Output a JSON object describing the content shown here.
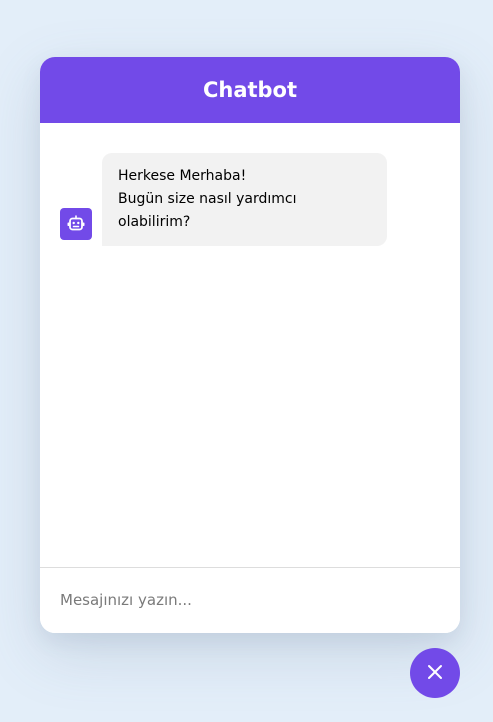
{
  "header": {
    "title": "Chatbot"
  },
  "messages": [
    {
      "sender": "bot",
      "icon": "robot-icon",
      "lines": [
        "Herkese Merhaba!",
        "Bugün size nasıl yardımcı",
        "olabilirim?"
      ]
    }
  ],
  "input": {
    "placeholder": "Mesajınızı yazın...",
    "value": ""
  },
  "toggler": {
    "icon": "close-icon"
  },
  "colors": {
    "accent": "#724ae8",
    "background": "#e3eef9",
    "bubble": "#f2f2f2"
  }
}
